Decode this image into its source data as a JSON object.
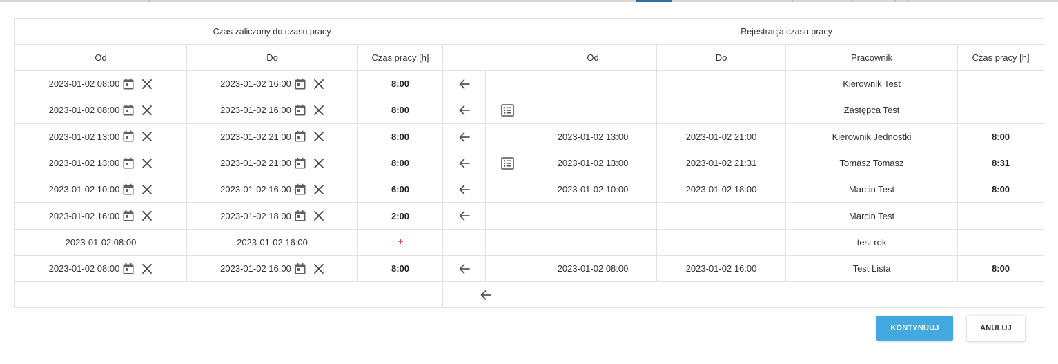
{
  "headers": {
    "left_group": "Czas zaliczony do czasu pracy",
    "right_group": "Rejestracja czasu pracy",
    "left_od": "Od",
    "left_do": "Do",
    "left_czas": "Czas pracy [h]",
    "right_od": "Od",
    "right_do": "Do",
    "right_pracownik": "Pracownik",
    "right_czas": "Czas pracy [h]"
  },
  "icons": {
    "calendar": "calendar-icon",
    "clear": "close-icon",
    "arrow": "arrow-left-icon",
    "details": "list-details-icon",
    "add": "plus-icon"
  },
  "rows": [
    {
      "od": "2023-01-02 08:00",
      "do": "2023-01-02 16:00",
      "czas": "8:00",
      "r_od": "",
      "r_do": "",
      "pracownik": "Kierownik Test",
      "r_czas": ""
    },
    {
      "od": "2023-01-02 08:00",
      "do": "2023-01-02 16:00",
      "czas": "8:00",
      "r_od": "",
      "r_do": "",
      "pracownik": "Zastępca Test",
      "r_czas": ""
    },
    {
      "od": "2023-01-02 13:00",
      "do": "2023-01-02 21:00",
      "czas": "8:00",
      "r_od": "2023-01-02 13:00",
      "r_do": "2023-01-02 21:00",
      "pracownik": "Kierownik Jednostki",
      "r_czas": "8:00"
    },
    {
      "od": "2023-01-02 13:00",
      "do": "2023-01-02 21:00",
      "czas": "8:00",
      "r_od": "2023-01-02 13:00",
      "r_do": "2023-01-02 21:31",
      "pracownik": "Tomasz Tomasz",
      "r_czas": "8:31"
    },
    {
      "od": "2023-01-02 10:00",
      "do": "2023-01-02 16:00",
      "czas": "6:00",
      "r_od": "2023-01-02 10:00",
      "r_do": "2023-01-02 18:00",
      "pracownik": "Marcin Test",
      "r_czas": "8:00"
    },
    {
      "od": "2023-01-02 16:00",
      "do": "2023-01-02 18:00",
      "czas": "2:00",
      "r_od": "",
      "r_do": "",
      "pracownik": "Marcin Test",
      "r_czas": ""
    },
    {
      "od": "2023-01-02 08:00",
      "do": "2023-01-02 16:00",
      "czas": "+",
      "r_od": "",
      "r_do": "",
      "pracownik": "test rok",
      "r_czas": ""
    },
    {
      "od": "2023-01-02 08:00",
      "do": "2023-01-02 16:00",
      "czas": "8:00",
      "r_od": "2023-01-02 08:00",
      "r_do": "2023-01-02 16:00",
      "pracownik": "Test Lista",
      "r_czas": "8:00"
    }
  ],
  "buttons": {
    "continue": "KONTYNUUJ",
    "cancel": "ANULUJ"
  },
  "colors": {
    "primary": "#44a9e0",
    "add": "#e53935",
    "active_tab": "#2c6fa0"
  }
}
